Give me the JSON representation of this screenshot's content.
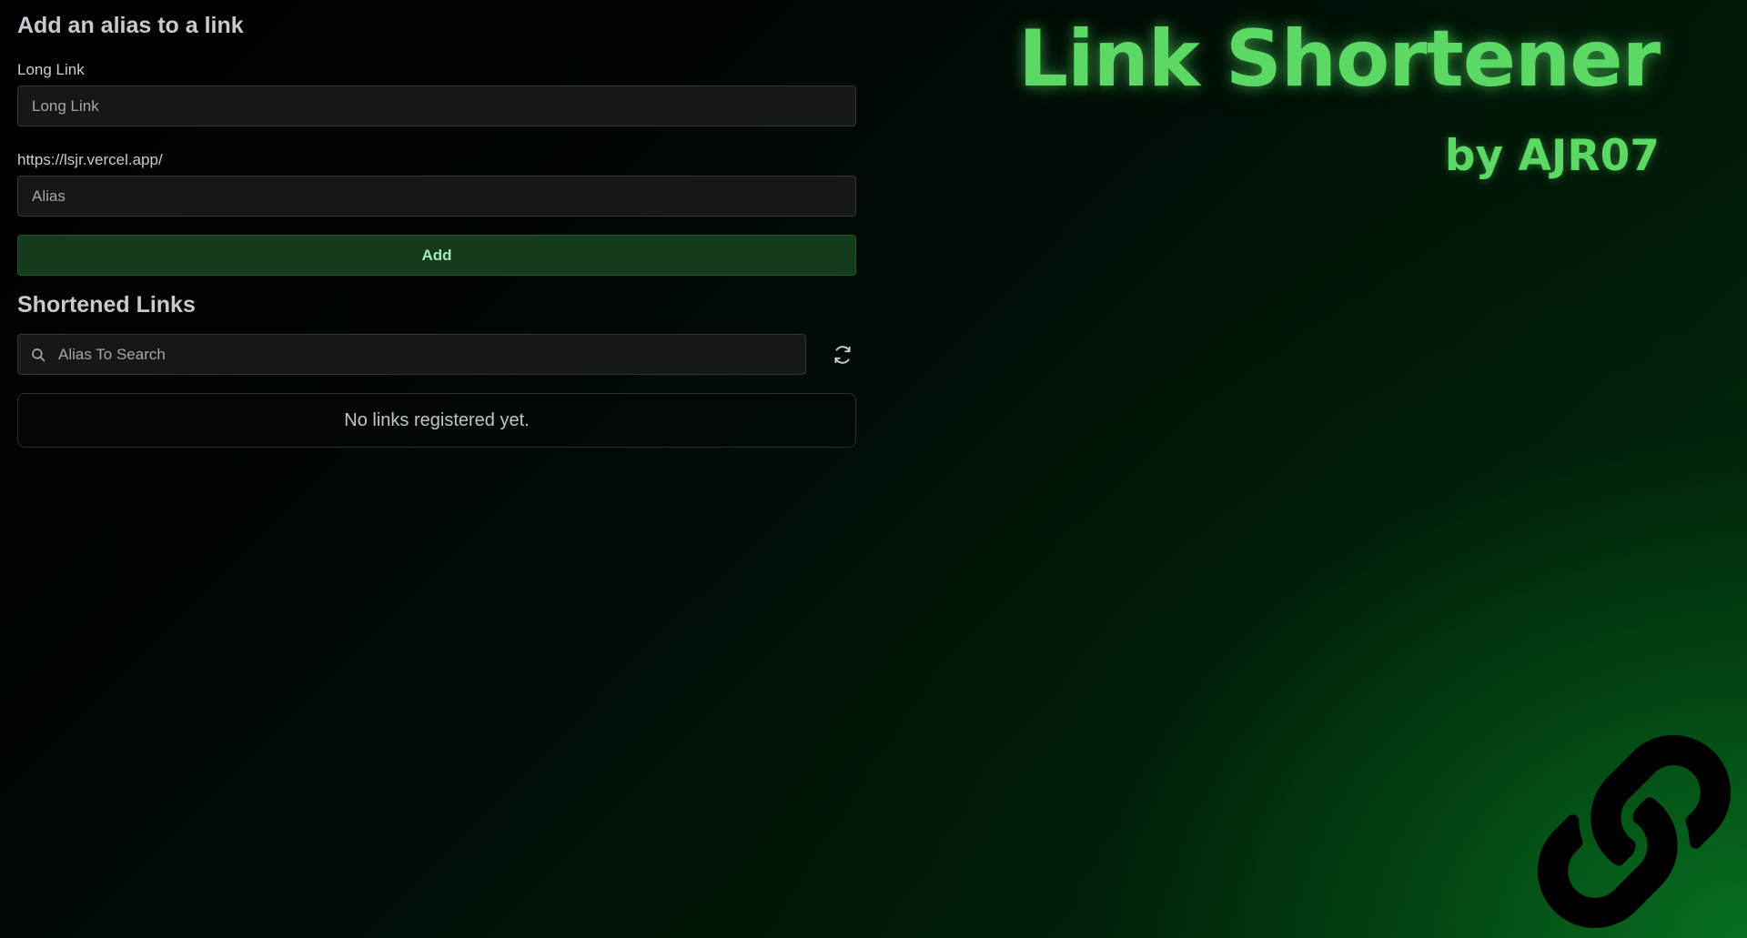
{
  "form": {
    "title": "Add an alias to a link",
    "long_link_label": "Long Link",
    "long_link_placeholder": "Long Link",
    "long_link_value": "",
    "prefix_label": "https://lsjr.vercel.app/",
    "alias_placeholder": "Alias",
    "alias_value": "",
    "add_button_label": "Add"
  },
  "links": {
    "title": "Shortened Links",
    "search_placeholder": "Alias To Search",
    "search_value": "",
    "empty_message": "No links registered yet."
  },
  "header": {
    "title": "Link Shortener",
    "author": "by AJR07"
  },
  "icons": {
    "search": "search-icon",
    "refresh": "refresh-icon",
    "logo": "link-chain-icon"
  },
  "colors": {
    "accent": "#5bd964",
    "button_bg": "#133b1c",
    "input_bg": "#161719"
  }
}
